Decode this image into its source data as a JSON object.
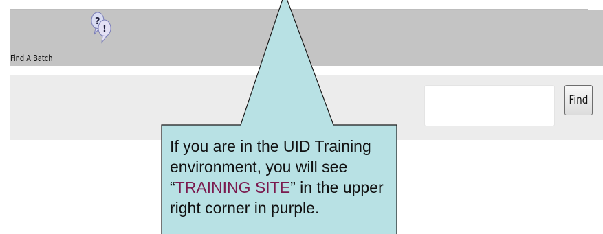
{
  "header": {
    "title": "Find A Batch",
    "help_icon": "help-bubbles-icon"
  },
  "search": {
    "input_value": "",
    "button_label": "Find"
  },
  "callout": {
    "text_before": "If you are in the UID Training environment, you will see “",
    "highlight": "TRAINING SITE",
    "text_after": "” in the upper right corner in purple.",
    "highlight_color": "#7a1a4e",
    "fill_color": "#b8e1e4"
  }
}
